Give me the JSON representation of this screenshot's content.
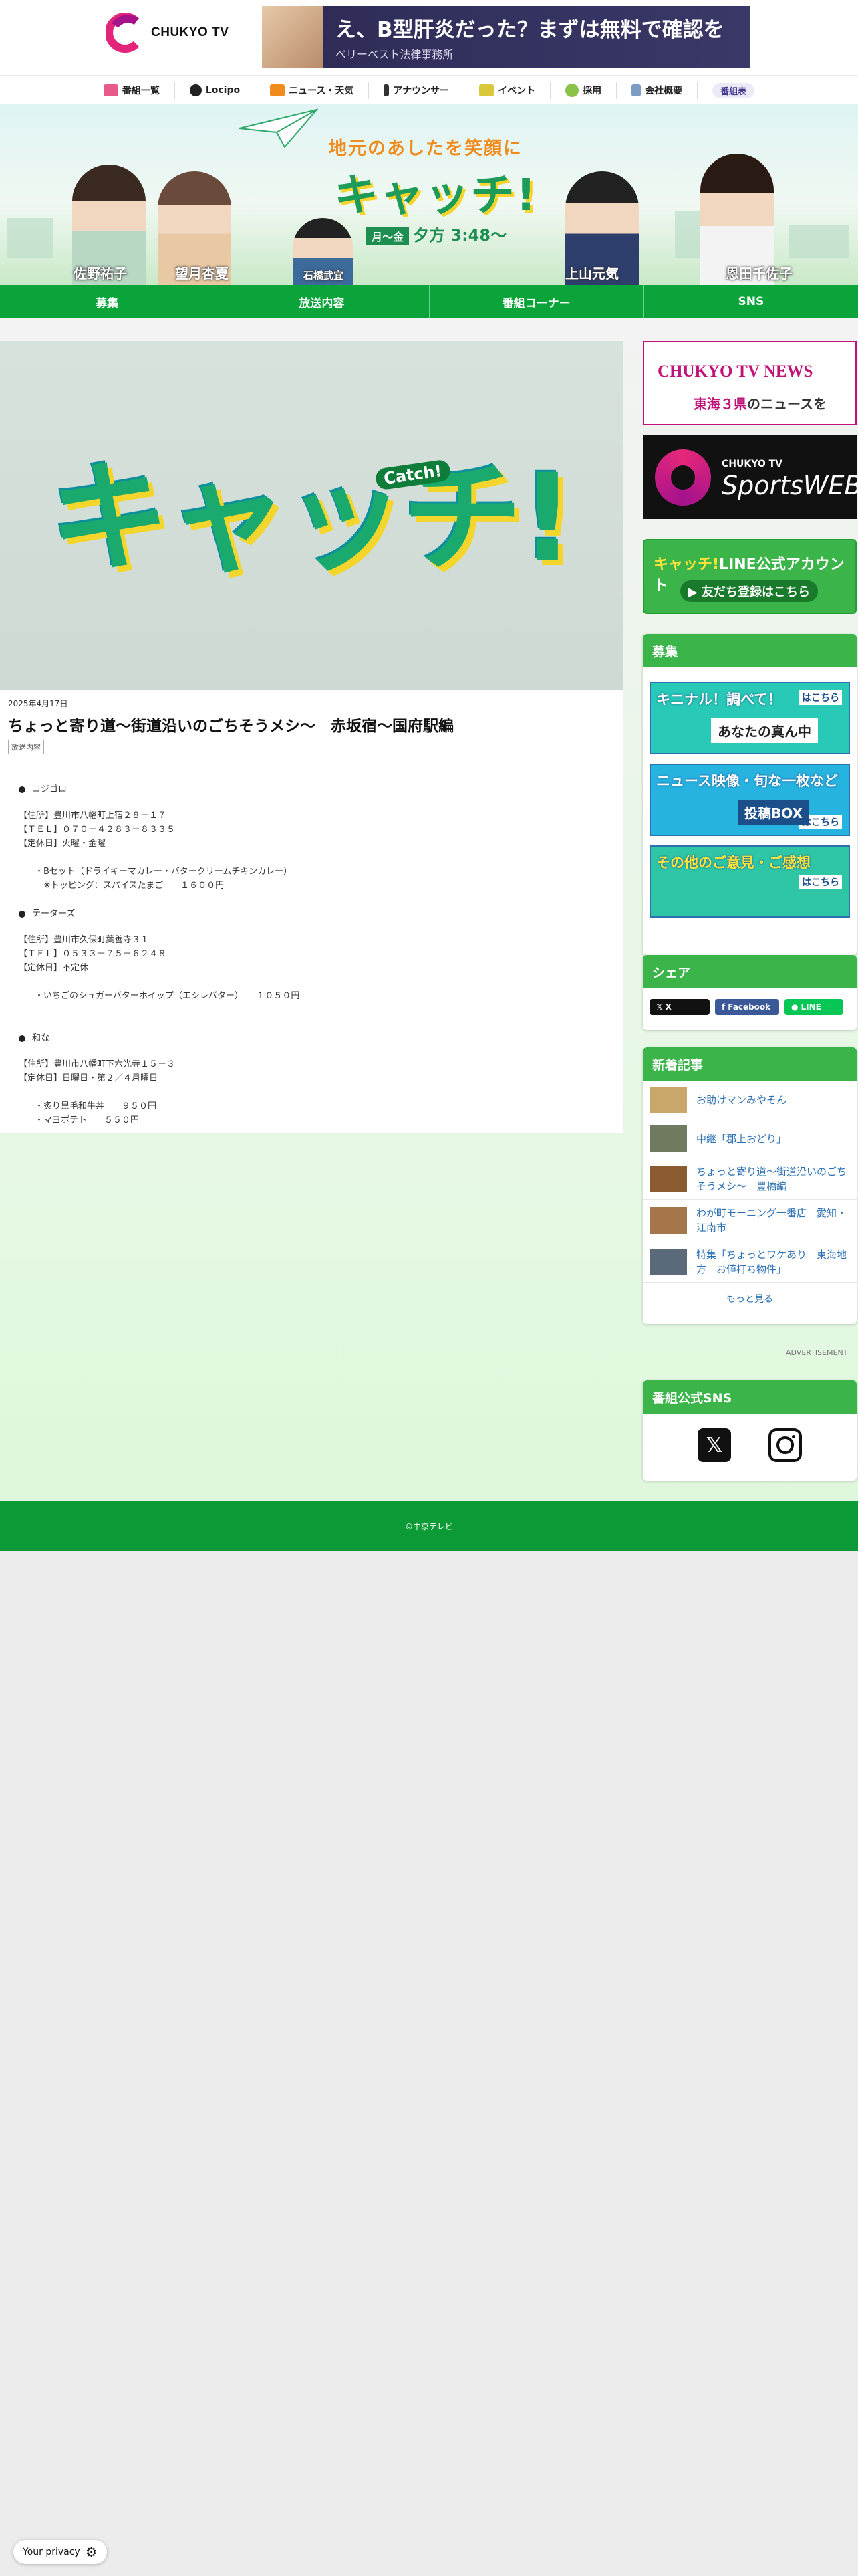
{
  "header": {
    "logo_text": "CHUKYO TV",
    "ad_headline": "え、B型肝炎だった？まずは無料で確認を",
    "ad_sub": "ベリーベスト法律事務所"
  },
  "topnav": [
    "番組一覧",
    "Locipo",
    "ニュース・天気",
    "アナウンサー",
    "イベント",
    "採用",
    "会社概要",
    "番組表"
  ],
  "hero": {
    "tagline": "地元のあしたを笑顔に",
    "title": "キャッチ!",
    "days": "月～金",
    "time": "夕方 3:48～",
    "hosts": [
      "佐野祐子",
      "望月杏夏",
      "石橋武宜",
      "上山元気",
      "恩田千佐子"
    ]
  },
  "greennav": [
    "募集",
    "放送内容",
    "番組コーナー",
    "SNS"
  ],
  "article": {
    "visual_title": "キャッチ!",
    "visual_catch": "Catch!",
    "date": "2025年4月17日",
    "title": "ちょっと寄り道～街道沿いのごちそうメシ～　赤坂宿～国府駅編",
    "tag": "放送内容",
    "sections": [
      {
        "name": "コジゴロ",
        "info": [
          "【住所】豊川市八幡町上宿２８－１７",
          "【ＴＥＬ】０７０－４２８３－８３３５",
          "【定休日】火曜・金曜"
        ],
        "items": [
          "・Bセット（ドライキーマカレー・バタークリームチキンカレー）",
          "　※トッピング：スパイスたまご　　１６００円"
        ]
      },
      {
        "name": "テーターズ",
        "info": [
          "【住所】豊川市久保町葉善寺３１",
          "【ＴＥＬ】０５３３－７５－６２４８",
          "【定休日】不定休"
        ],
        "items": [
          "・いちごのシュガーバターホイップ（エシレバター）　　１０５０円"
        ]
      },
      {
        "name": "和な",
        "info": [
          "【住所】豊川市八幡町下六光寺１５－３",
          "【定休日】日曜日・第２／４月曜日"
        ],
        "items": [
          "・炙り黒毛和牛丼　　９５０円",
          "・マヨポテト　　５５０円"
        ]
      }
    ]
  },
  "sidebar": {
    "news_banner": {
      "brand": "CHUKYO TV",
      "suffix": "NEWS",
      "sub_pre": "東海３県",
      "sub_post": "のニュースを"
    },
    "sports_banner": {
      "brand": "CHUKYO TV",
      "name": "SportsWEB"
    },
    "line_banner": {
      "prefix": "キャッチ!",
      "title": "LINE公式アカウント",
      "button": "▶ 友だち登録はこちら"
    },
    "recruit": {
      "heading": "募集",
      "items": [
        {
          "title": "キニナル！調べて！",
          "sub": "はこちら",
          "main": "あなたの真ん中"
        },
        {
          "title": "ニュース映像・旬な一枚など",
          "sub": "はこちら",
          "main": "投稿BOX"
        },
        {
          "title": "その他のご意見・ご感想",
          "sub": "はこちら",
          "main": ""
        }
      ]
    },
    "share": {
      "heading": "シェア",
      "x": "X",
      "facebook": "Facebook",
      "line": "LINE"
    },
    "news": {
      "heading": "新着記事",
      "items": [
        "お助けマンみやそん",
        "中継「郡上おどり」",
        "ちょっと寄り道～街道沿いのごちそうメシ～　豊橋編",
        "わが町モーニング一番店　愛知・江南市",
        "特集「ちょっとワケあり　東海地方　お値打ち物件」"
      ],
      "more": "もっと見る"
    },
    "advertisement": "ADVERTISEMENT",
    "sns": {
      "heading": "番組公式SNS"
    }
  },
  "footer": {
    "copyright": "©中京テレビ"
  },
  "privacy": {
    "label": "Your privacy"
  }
}
